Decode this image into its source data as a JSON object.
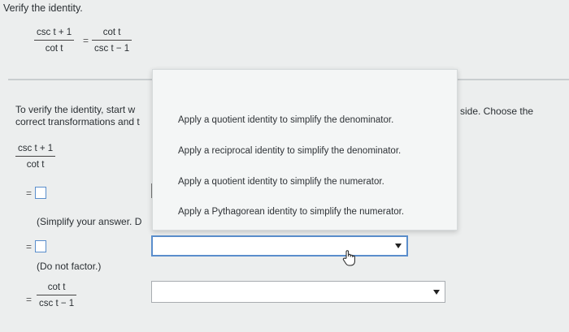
{
  "header": {
    "instruction": "Verify the identity.",
    "identity": {
      "lhs_num": "csc t + 1",
      "lhs_den": "cot t",
      "eq": "=",
      "rhs_num": "cot t",
      "rhs_den": "csc t − 1"
    }
  },
  "work": {
    "prompt_line1": "To verify the identity, start w",
    "prompt_line2": "correct transformations and t",
    "prompt_tail": "side. Choose the",
    "step0_num": "csc t + 1",
    "step0_den": "cot t",
    "eq": "=",
    "hint1": "(Simplify your answer. D",
    "hint2": "(Do not factor.)",
    "final_num": "cot t",
    "final_den": "csc t − 1"
  },
  "dropdown": {
    "options": [
      "Apply a quotient identity to simplify the denominator.",
      "Apply a reciprocal identity to simplify the denominator.",
      "Apply a quotient identity to simplify the numerator.",
      "Apply a Pythagorean identity to simplify the numerator."
    ]
  },
  "icons": {
    "caret": "chevron-down-icon",
    "cursor": "hand-pointer-icon"
  },
  "colors": {
    "accent": "#5a8ecc",
    "background": "#eceeee"
  }
}
